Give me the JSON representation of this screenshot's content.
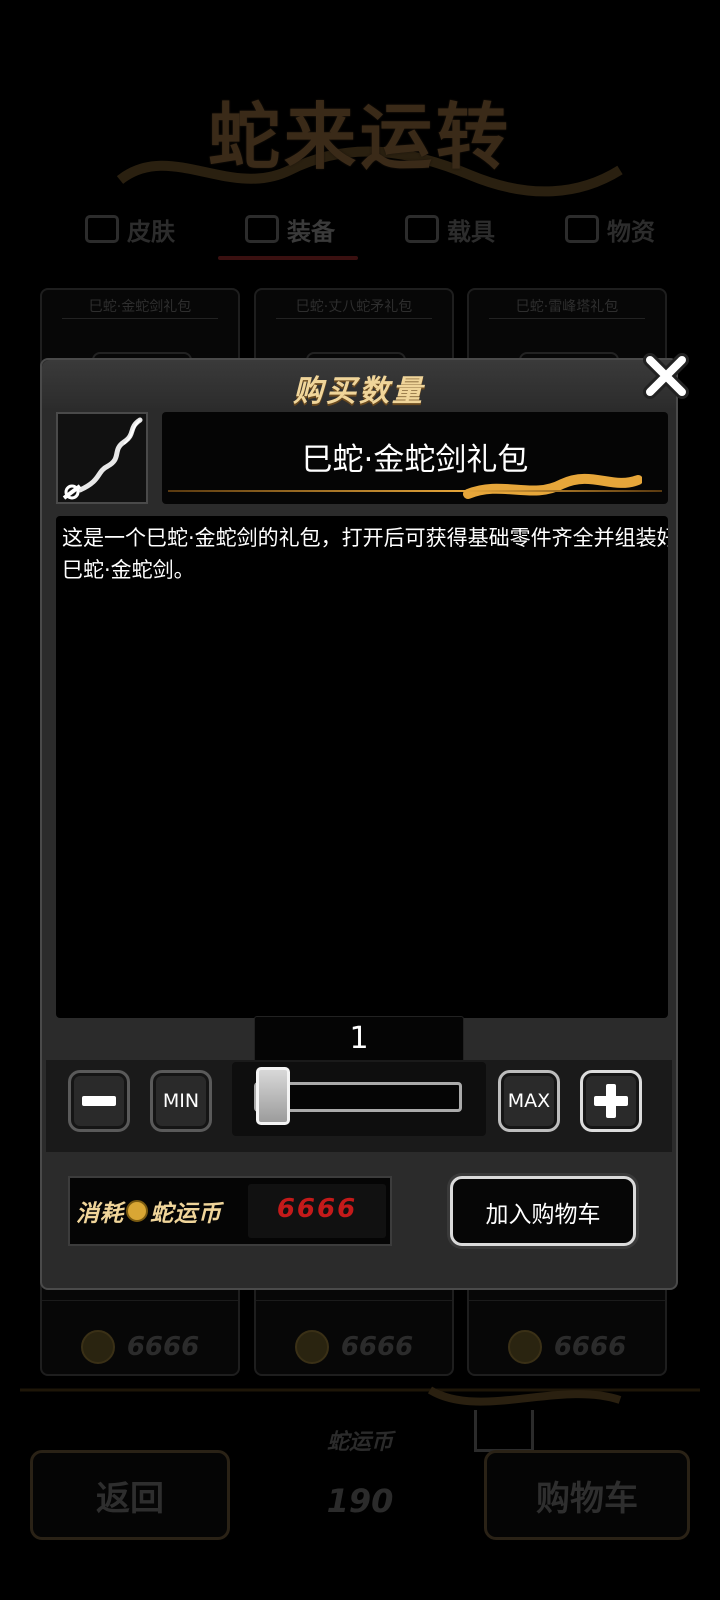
{
  "background": {
    "shop_title": "蛇来运转",
    "tabs": [
      {
        "label": "皮肤",
        "icon": "gift-box-icon"
      },
      {
        "label": "装备",
        "icon": "shield-icon"
      },
      {
        "label": "载具",
        "icon": "car-icon"
      },
      {
        "label": "物资",
        "icon": "supply-crate-icon"
      }
    ],
    "active_tab": "装备",
    "cards": [
      {
        "title": "巳蛇·金蛇剑礼包",
        "price": "6666"
      },
      {
        "title": "巳蛇·丈八蛇矛礼包",
        "price": "6666"
      },
      {
        "title": "巳蛇·雷峰塔礼包",
        "price": "6666"
      }
    ],
    "balance_label": "蛇运币",
    "balance_value": "190",
    "back_label": "返回",
    "cart_label": "购物车"
  },
  "dialog": {
    "title": "购买数量",
    "close_icon": "close-x-icon",
    "item_icon": "golden-snake-sword-icon",
    "item_name": "巳蛇·金蛇剑礼包",
    "description": "这是一个巳蛇·金蛇剑的礼包，打开后可获得基础零件齐全并组装好的巳蛇·金蛇剑。",
    "quantity": "1",
    "min_label": "MIN",
    "max_label": "MAX",
    "slider_fraction": 0.0,
    "cost_label_prefix": "消耗",
    "cost_currency": "蛇运币",
    "cost_value": "6666",
    "add_to_cart_label": "加入购物车",
    "accent_color": "#f0d59a",
    "cost_color": "#c41a1a"
  }
}
